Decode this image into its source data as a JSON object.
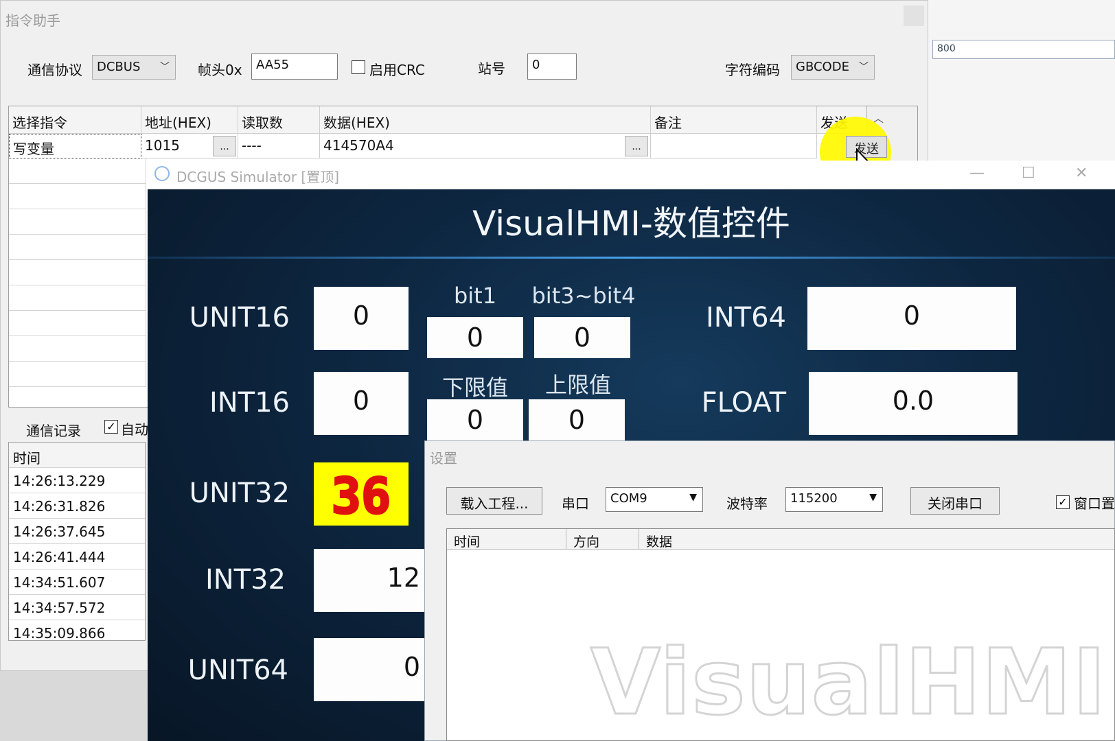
{
  "bg_window": {
    "title": "指令助手",
    "protocol_label": "通信协议",
    "protocol_value": "DCBUS",
    "header_label": "帧头0x",
    "header_value": "AA55",
    "crc_label": "启用CRC",
    "station_label": "站号",
    "station_value": "0",
    "encoding_label": "字符编码",
    "encoding_value": "GBCODE",
    "columns": [
      "选择指令",
      "地址(HEX)",
      "读取数",
      "数据(HEX)",
      "备注",
      "发送"
    ],
    "row": {
      "command": "写变量",
      "address": "1015",
      "read_count": "----",
      "data": "414570A4",
      "note": "",
      "send": "发送"
    },
    "ellipsis": "...",
    "log_label": "通信记录",
    "auto_label": "自动",
    "log_header": "时间",
    "log_times": [
      "14:26:13.229",
      "14:26:31.826",
      "14:26:37.645",
      "14:26:41.444",
      "14:34:51.607",
      "14:34:57.572",
      "14:35:09.866"
    ],
    "ruler_value": "800"
  },
  "simulator": {
    "title": "DCGUS Simulator [置顶]",
    "minimize": "—",
    "maximize": "☐",
    "close": "✕",
    "hmi_title": "VisualHMI-数值控件",
    "labels": {
      "unit16": "UNIT16",
      "int16": "INT16",
      "unit32": "UNIT32",
      "int32": "INT32",
      "unit64": "UNIT64",
      "int64": "INT64",
      "float": "FLOAT",
      "bit1": "bit1",
      "bit34": "bit3~bit4",
      "low": "下限值",
      "high": "上限值"
    },
    "values": {
      "unit16": "0",
      "int16": "0",
      "unit32": "36",
      "int32": "12",
      "unit64": "0",
      "int64": "0",
      "float": "0.0",
      "bit1": "0",
      "bit34": "0",
      "low": "0",
      "high": "0"
    },
    "colors": {
      "unit32_bg": "#ffff00",
      "unit32_fg": "#e01010"
    }
  },
  "settings": {
    "title": "设置",
    "load_button": "载入工程...",
    "port_label": "串口",
    "port_value": "COM9",
    "baud_label": "波特率",
    "baud_value": "115200",
    "close_port_button": "关闭串口",
    "window_top_label": "窗口置",
    "log_columns": [
      "时间",
      "方向",
      "数据"
    ],
    "watermark": "VisualHMI"
  }
}
